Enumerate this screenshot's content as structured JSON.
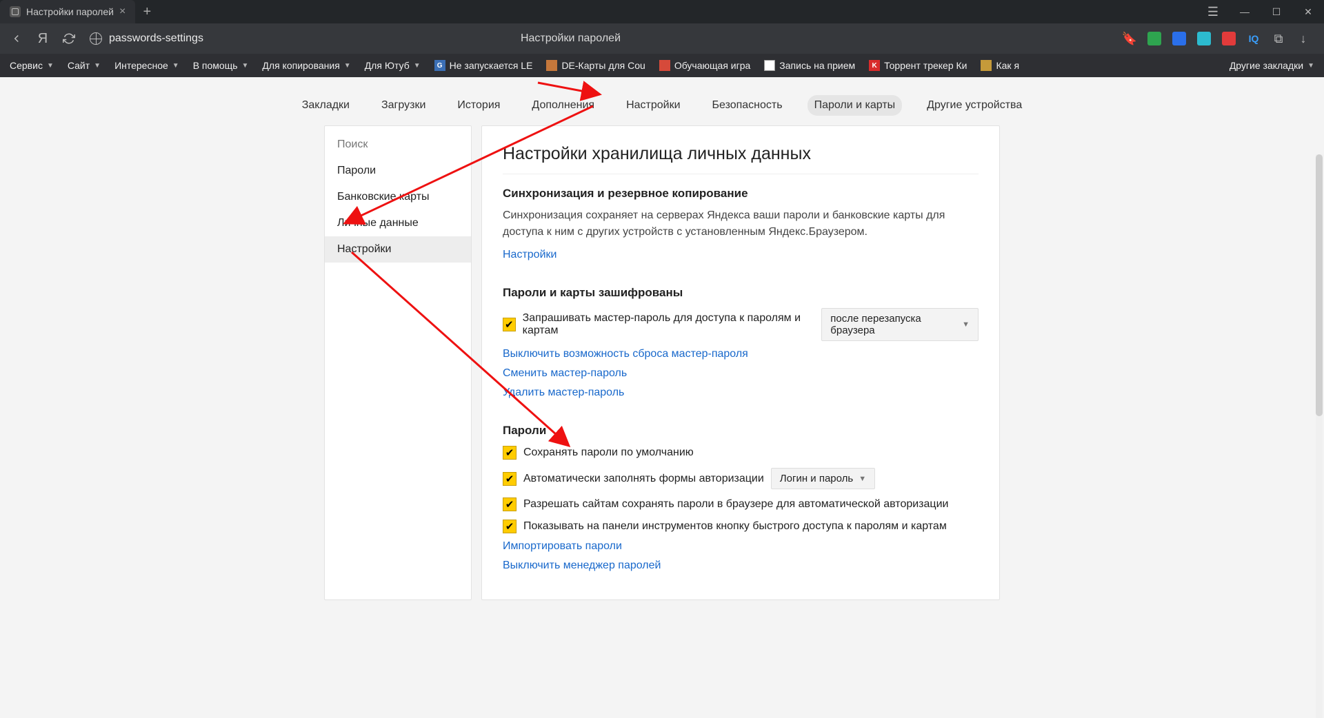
{
  "titlebar": {
    "tab_title": "Настройки паролей"
  },
  "addressbar": {
    "url": "passwords-settings",
    "page_title": "Настройки паролей"
  },
  "bookmarks_bar": {
    "folders": [
      "Сервис",
      "Сайт",
      "Интересное",
      "В помощь",
      "Для копирования",
      "Для Ютуб"
    ],
    "items": [
      {
        "favcolor": "#3b6fb5",
        "label": "G",
        "text": "Не запускается LE"
      },
      {
        "favcolor": "#c5773b",
        "label": "",
        "text": "DE-Карты для Cou"
      },
      {
        "favcolor": "#d64a3a",
        "label": "",
        "text": "Обучающая игра"
      },
      {
        "favcolor": "#ffffff",
        "label": "🇷🇺",
        "text": "Запись на прием"
      },
      {
        "favcolor": "#d92b2b",
        "label": "K",
        "text": "Торрент трекер Ки"
      },
      {
        "favcolor": "#c59a3a",
        "label": "",
        "text": "Как я"
      }
    ],
    "other": "Другие закладки"
  },
  "settings_tabs": [
    "Закладки",
    "Загрузки",
    "История",
    "Дополнения",
    "Настройки",
    "Безопасность",
    "Пароли и карты",
    "Другие устройства"
  ],
  "settings_tabs_active_index": 6,
  "sidebar": {
    "search_placeholder": "Поиск",
    "items": [
      "Пароли",
      "Банковские карты",
      "Личные данные",
      "Настройки"
    ],
    "active_index": 3
  },
  "main": {
    "h1": "Настройки хранилища личных данных",
    "sync": {
      "title": "Синхронизация и резервное копирование",
      "desc": "Синхронизация сохраняет на серверах Яндекса ваши пароли и банковские карты для доступа к ним с других устройств с установленным Яндекс.Браузером.",
      "link": "Настройки"
    },
    "encrypted": {
      "title": "Пароли и карты зашифрованы",
      "cb_label": "Запрашивать мастер-пароль для доступа к паролям и картам",
      "select_value": "после перезапуска браузера",
      "links": [
        "Выключить возможность сброса мастер-пароля",
        "Сменить мастер-пароль",
        "Удалить мастер-пароль"
      ]
    },
    "passwords": {
      "title": "Пароли",
      "rows": [
        "Сохранять пароли по умолчанию",
        "Автоматически заполнять формы авторизации",
        "Разрешать сайтам сохранять пароли в браузере для автоматической авторизации",
        "Показывать на панели инструментов кнопку быстрого доступа к паролям и картам"
      ],
      "autofill_select": "Логин и пароль",
      "links": [
        "Импортировать пароли",
        "Выключить менеджер паролей"
      ]
    }
  }
}
